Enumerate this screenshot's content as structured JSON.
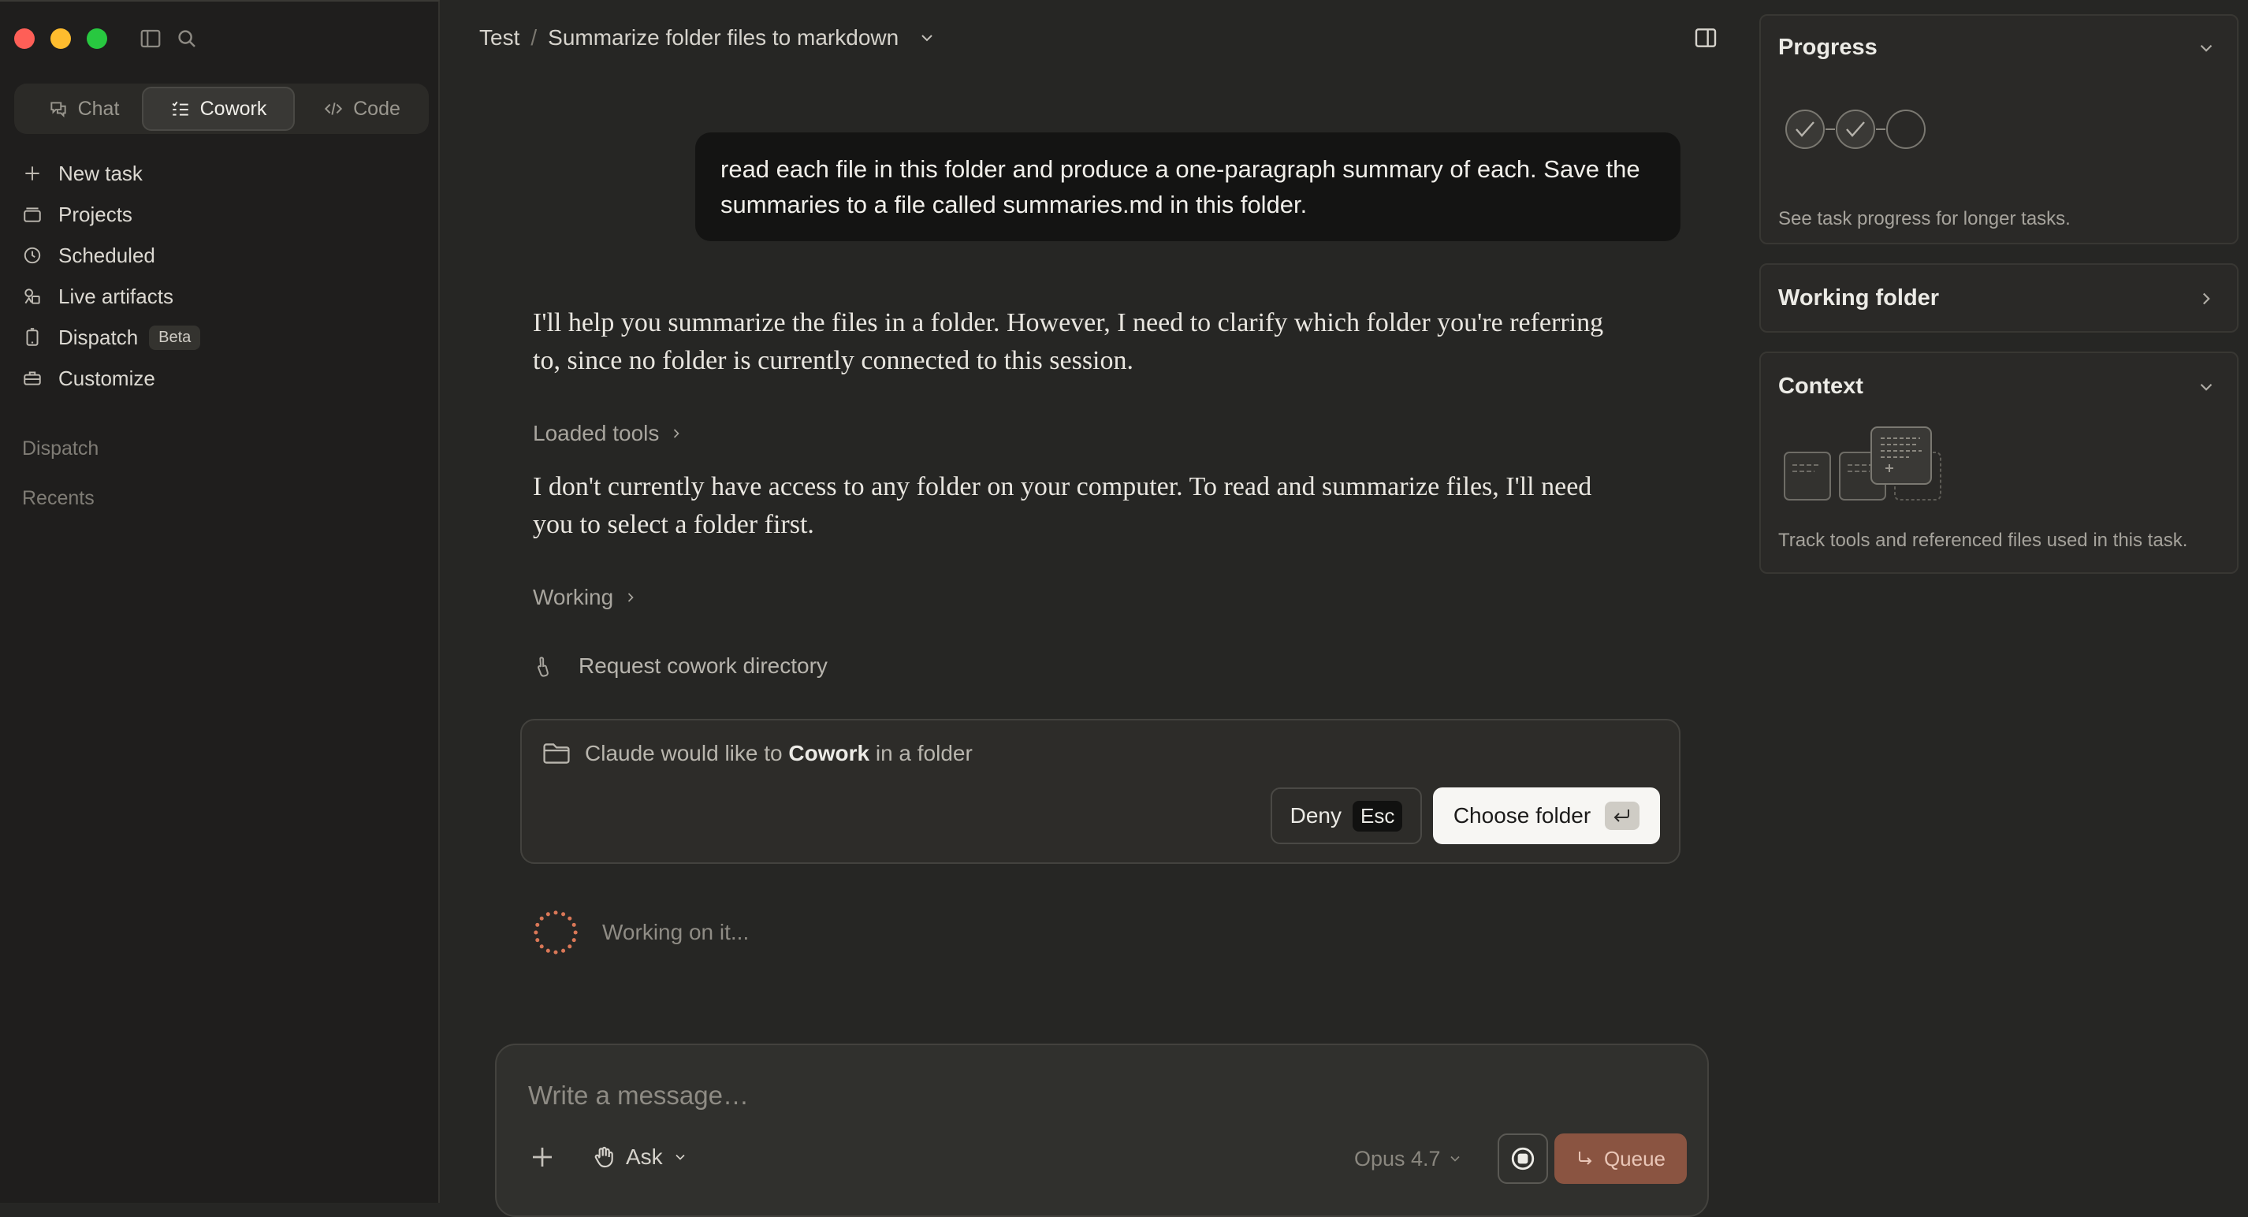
{
  "sidebar": {
    "tabs": [
      {
        "label": "Chat",
        "icon": "chat-bubbles-icon"
      },
      {
        "label": "Cowork",
        "icon": "checklist-icon",
        "active": true
      },
      {
        "label": "Code",
        "icon": "code-brackets-icon"
      }
    ],
    "nav": [
      {
        "label": "New task",
        "icon": "plus-icon"
      },
      {
        "label": "Projects",
        "icon": "folder-stack-icon"
      },
      {
        "label": "Scheduled",
        "icon": "clock-icon"
      },
      {
        "label": "Live artifacts",
        "icon": "shapes-icon"
      },
      {
        "label": "Dispatch",
        "icon": "phone-icon",
        "badge": "Beta"
      },
      {
        "label": "Customize",
        "icon": "briefcase-icon"
      }
    ],
    "sections": [
      "Dispatch",
      "Recents"
    ]
  },
  "header": {
    "project": "Test",
    "separator": "/",
    "title": "Summarize folder files to markdown"
  },
  "conversation": {
    "user_message": "read each file in this folder and produce a one-paragraph summary of each. Save the summaries to a file called summaries.md in this folder.",
    "assistant_para1": "I'll help you summarize the files in a folder. However, I need to clarify which folder you're referring to, since no folder is currently connected to this session.",
    "loaded_tools_label": "Loaded tools",
    "assistant_para2": "I don't currently have access to any folder on your computer. To read and summarize files, I'll need you to select a folder first.",
    "working_label": "Working",
    "tool_call_label": "Request cowork directory"
  },
  "permission": {
    "prefix": "Claude would like to",
    "bold": "Cowork",
    "suffix": "in a folder",
    "deny_label": "Deny",
    "deny_key": "Esc",
    "choose_label": "Choose folder"
  },
  "status": {
    "working_text": "Working on it..."
  },
  "composer": {
    "placeholder": "Write a message…",
    "mode_label": "Ask",
    "model_label": "Opus 4.7",
    "queue_label": "Queue"
  },
  "right_panel": {
    "progress": {
      "title": "Progress",
      "description": "See task progress for longer tasks.",
      "steps": [
        "done",
        "done",
        "pending"
      ]
    },
    "working_folder": {
      "title": "Working folder"
    },
    "context": {
      "title": "Context",
      "description": "Track tools and referenced files used in this task."
    }
  },
  "colors": {
    "background": "#262624",
    "sidebar": "#1f1e1d",
    "accent": "#8a5441",
    "spinner": "#d97757",
    "close": "#fe5f57",
    "minimize": "#febc2e",
    "maximize": "#28c840"
  }
}
